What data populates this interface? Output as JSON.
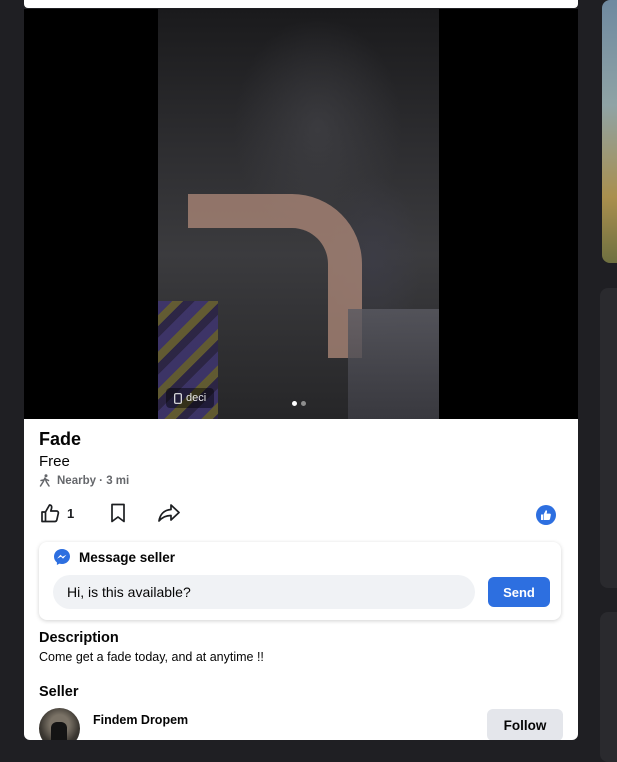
{
  "listing": {
    "media_tag": "deci",
    "title": "Fade",
    "price": "Free",
    "location": "Nearby · 3 mi",
    "like_count": "1"
  },
  "message": {
    "header": "Message seller",
    "input_value": "Hi, is this available?",
    "send_label": "Send"
  },
  "description": {
    "header": "Description",
    "text": "Come get a fade today, and at anytime !!"
  },
  "seller": {
    "header": "Seller",
    "name": "Findem Dropem",
    "follow_label": "Follow"
  },
  "media": {
    "page_count": 2,
    "active_page": 1
  },
  "colors": {
    "accent": "#2d6fe0",
    "text": "#050505",
    "muted": "#65676b"
  }
}
